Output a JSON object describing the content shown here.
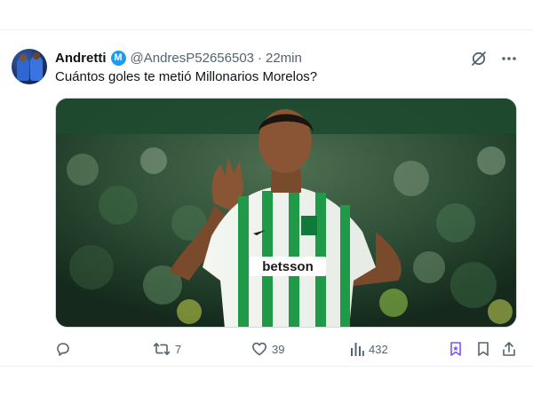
{
  "tweet": {
    "author": {
      "display_name": "Andretti",
      "badge": "M",
      "handle": "@AndresP52656503",
      "separator": "·",
      "timestamp": "22min"
    },
    "text": "Cuántos goles te metió Millonarios Morelos?",
    "media": {
      "alt_description": "player-photo",
      "jersey_sponsor": "betsson"
    },
    "stats": {
      "replies": "",
      "retweets": "7",
      "likes": "39",
      "views": "432"
    }
  },
  "colors": {
    "accent": "#1d9bf0",
    "muted": "#536471",
    "grok": "#7856ff"
  },
  "icons": {
    "top": [
      "grok-slash-icon",
      "more-icon"
    ],
    "actions": [
      "reply-icon",
      "retweet-icon",
      "like-icon",
      "views-icon",
      "grok-bookmark-icon",
      "bookmark-icon",
      "share-icon"
    ]
  }
}
